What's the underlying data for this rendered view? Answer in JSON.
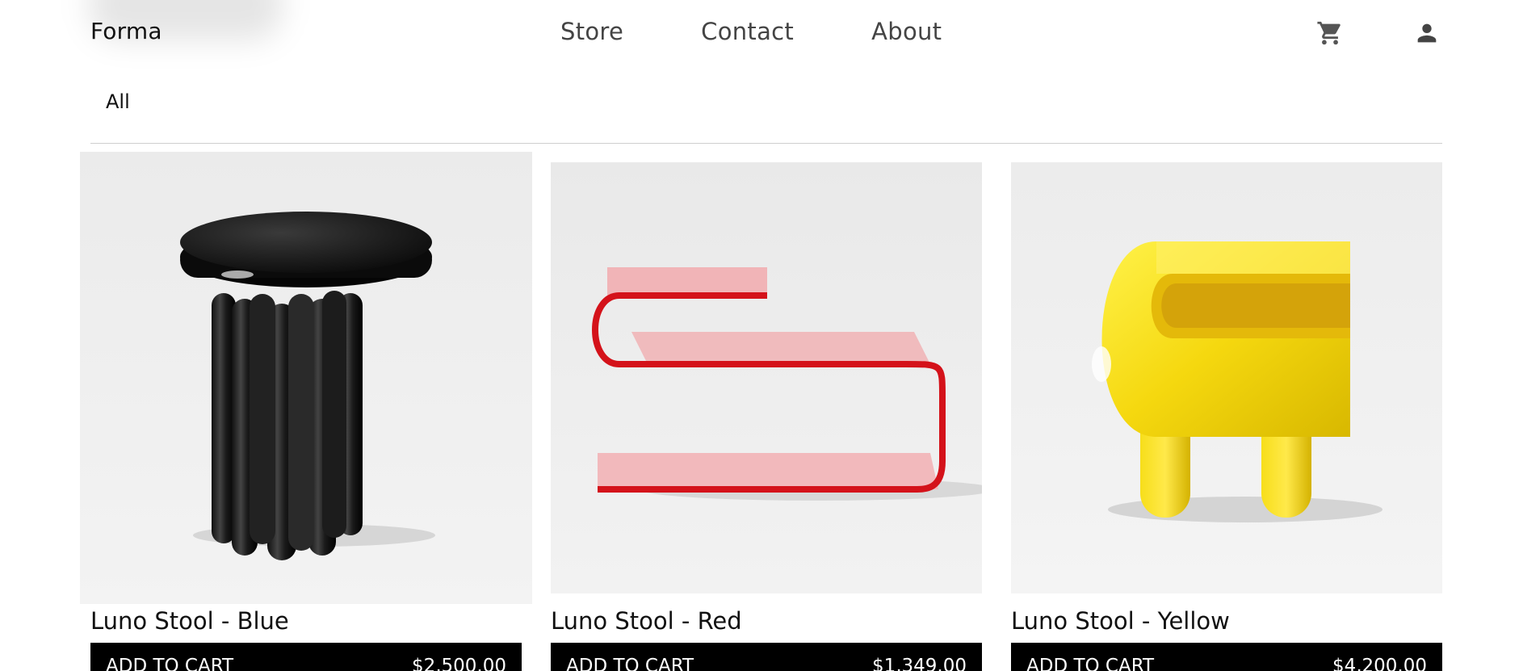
{
  "header": {
    "brand": "Forma",
    "nav": [
      {
        "label": "Store"
      },
      {
        "label": "Contact"
      },
      {
        "label": "About"
      }
    ],
    "icons": {
      "cart": "shopping-cart-icon",
      "account": "user-account-icon"
    }
  },
  "filters": {
    "active": "All"
  },
  "products": [
    {
      "title": "Luno Stool - Blue",
      "cta": "ADD TO CART",
      "price": "$2,500.00",
      "image": "black-fluted-stool"
    },
    {
      "title": "Luno Stool - Red",
      "cta": "ADD TO CART",
      "price": "$1,349.00",
      "image": "red-s-shaped-bench"
    },
    {
      "title": "Luno Stool - Yellow",
      "cta": "ADD TO CART",
      "price": "$4,200.00",
      "image": "yellow-tube-chair"
    }
  ],
  "colors": {
    "accent_bar": "#000000",
    "nav_text": "#444444",
    "image_bg": "#ececec"
  }
}
